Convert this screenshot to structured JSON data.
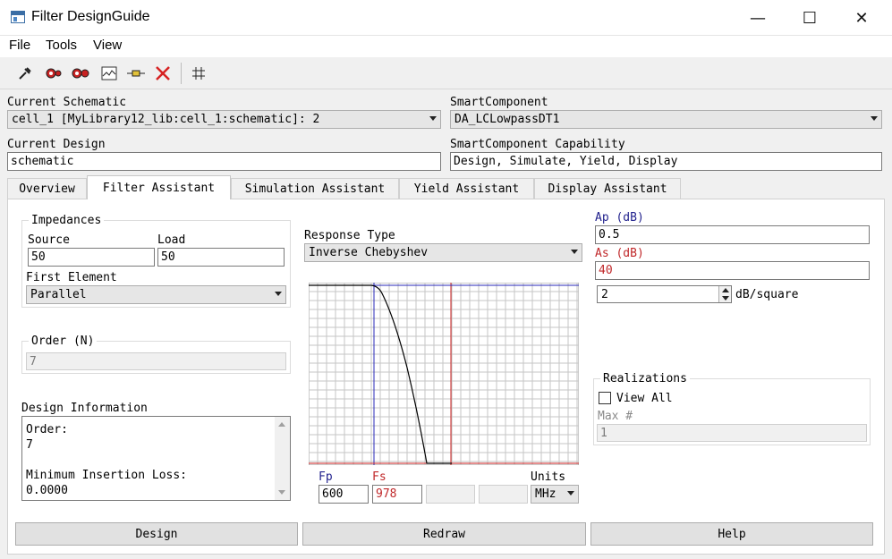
{
  "window": {
    "title": "Filter DesignGuide"
  },
  "menu": [
    "File",
    "Tools",
    "View"
  ],
  "toolbar": {
    "icons": [
      "tune-icon",
      "gear-icon",
      "gears-icon",
      "waveform-icon",
      "component-icon",
      "delete-icon",
      "grid-icon"
    ]
  },
  "header": {
    "current_schematic_label": "Current Schematic",
    "current_schematic_value": "cell_1 [MyLibrary12_lib:cell_1:schematic]: 2",
    "smartcomponent_label": "SmartComponent",
    "smartcomponent_value": "DA_LCLowpassDT1",
    "current_design_label": "Current Design",
    "current_design_value": "schematic",
    "capability_label": "SmartComponent Capability",
    "capability_value": "Design, Simulate, Yield, Display"
  },
  "tabs": [
    "Overview",
    "Filter Assistant",
    "Simulation Assistant",
    "Yield Assistant",
    "Display Assistant"
  ],
  "impedances": {
    "group_label": "Impedances",
    "source_label": "Source",
    "source_value": "50",
    "load_label": "Load",
    "load_value": "50",
    "first_element_label": "First Element",
    "first_element_value": "Parallel"
  },
  "order": {
    "label": "Order (N)",
    "value": "7"
  },
  "design_info": {
    "label": "Design Information",
    "line1": "Order:",
    "line2": "7",
    "line3": "Minimum Insertion Loss:",
    "line4": "0.0000"
  },
  "response": {
    "label": "Response Type",
    "value": "Inverse Chebyshev"
  },
  "spec": {
    "ap_label": "Ap (dB)",
    "ap_value": "0.5",
    "as_label": "As (dB)",
    "as_value": "40",
    "slope_value": "2",
    "slope_unit": "dB/square"
  },
  "freq": {
    "fp_label": "Fp",
    "fp_value": "600",
    "fs_label": "Fs",
    "fs_value": "978",
    "units_label": "Units",
    "units_value": "MHz"
  },
  "realizations": {
    "label": "Realizations",
    "view_all_label": "View All",
    "view_all_checked": false,
    "max_label": "Max #",
    "max_value": "1"
  },
  "buttons": {
    "design": "Design",
    "redraw": "Redraw",
    "help": "Help"
  },
  "colors": {
    "fp_line": "#2a2ab8",
    "fs_line": "#cc2222",
    "grid": "#c6c6c6"
  }
}
